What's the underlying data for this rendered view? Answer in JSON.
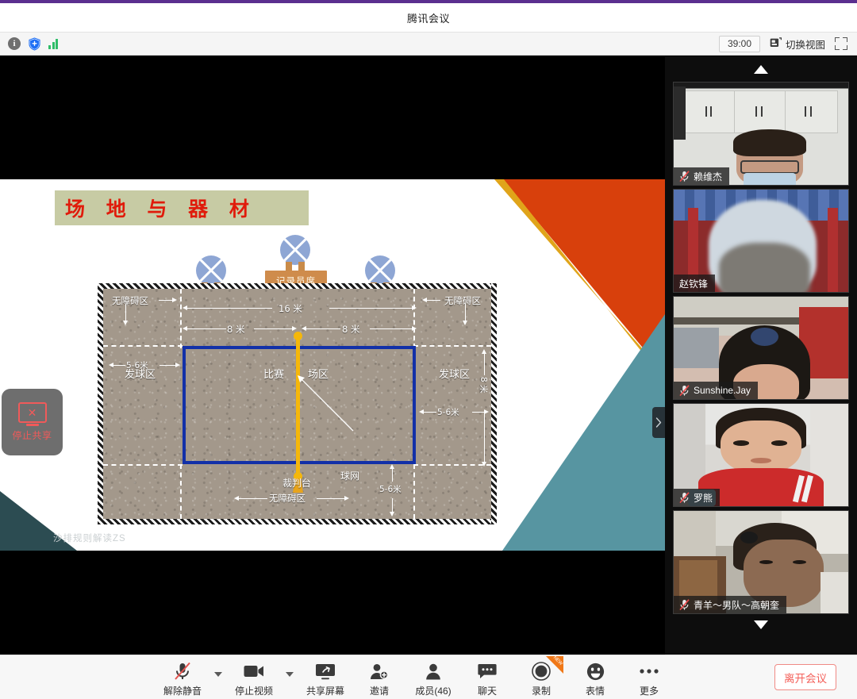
{
  "window": {
    "title": "腾讯会议"
  },
  "toolbar": {
    "icons": [
      {
        "name": "info-icon",
        "glyph": "i"
      },
      {
        "name": "security-shield-icon",
        "glyph": "+"
      },
      {
        "name": "network-signal-icon",
        "glyph": "bars"
      }
    ],
    "timer": "39:00",
    "view_switch_label": "切换视图",
    "fullscreen_label": "全屏"
  },
  "share": {
    "stop_share_label": "停止共享",
    "collapse_handle": "›"
  },
  "slide": {
    "title": "场 地 与 器 材",
    "watermark": "沙排规则解读ZS",
    "scorer_table": "记录员席",
    "labels": {
      "free_zone_left": "无障碍区",
      "free_zone_right": "无障碍区",
      "free_zone_bottom": "无障碍区",
      "dim_16m": "16 米",
      "dim_8m_left": "8 米",
      "dim_8m_right": "8 米",
      "dim_8m_vertical": "8 米",
      "dim_5_6m_left": "5-6米",
      "dim_5_6m_right": "5-6米",
      "dim_5_6m_bottom": "5-6米",
      "serve_zone_left": "发球区",
      "serve_zone_right": "发球区",
      "play_area_a": "比赛",
      "play_area_b": "场区",
      "net": "球网",
      "referee_stand": "裁判台"
    },
    "colors": {
      "title_text": "#e01b0b",
      "title_bg": "#c7cba4",
      "orange": "#d8400c",
      "gold": "#e0a41a",
      "teal": "#5795a1",
      "dark_teal": "#2c4c52",
      "court_line": "#1230a8",
      "net_color": "#f5b70a",
      "sand": "#a3988b"
    }
  },
  "participants": {
    "scroll_up": "▲",
    "scroll_down": "▼",
    "tiles": [
      {
        "name": "赖维杰",
        "muted": true
      },
      {
        "name": "赵钦锋",
        "muted": false
      },
      {
        "name": "Sunshine.Jay",
        "muted": true
      },
      {
        "name": "罗熊",
        "muted": true
      },
      {
        "name": "青羊～男队～高朝奎",
        "muted": true
      }
    ]
  },
  "bottom_bar": {
    "items": [
      {
        "label": "解除静音",
        "icon": "mic-off-icon",
        "caret": true,
        "badge": null
      },
      {
        "label": "停止视频",
        "icon": "video-camera-icon",
        "caret": true,
        "badge": null
      },
      {
        "label": "共享屏幕",
        "icon": "screen-share-icon",
        "caret": false,
        "badge": null
      },
      {
        "label": "邀请",
        "icon": "invite-person-icon",
        "caret": false,
        "badge": null
      },
      {
        "label": "成员(46)",
        "icon": "participants-icon",
        "caret": false,
        "badge": null
      },
      {
        "label": "聊天",
        "icon": "chat-bubble-icon",
        "caret": false,
        "badge": null
      },
      {
        "label": "录制",
        "icon": "record-icon",
        "caret": false,
        "badge": "NEW"
      },
      {
        "label": "表情",
        "icon": "emoji-icon",
        "caret": false,
        "badge": null
      },
      {
        "label": "更多",
        "icon": "more-dots-icon",
        "caret": false,
        "badge": null
      }
    ],
    "leave_label": "离开会议",
    "leave_color": "#f4605a"
  }
}
